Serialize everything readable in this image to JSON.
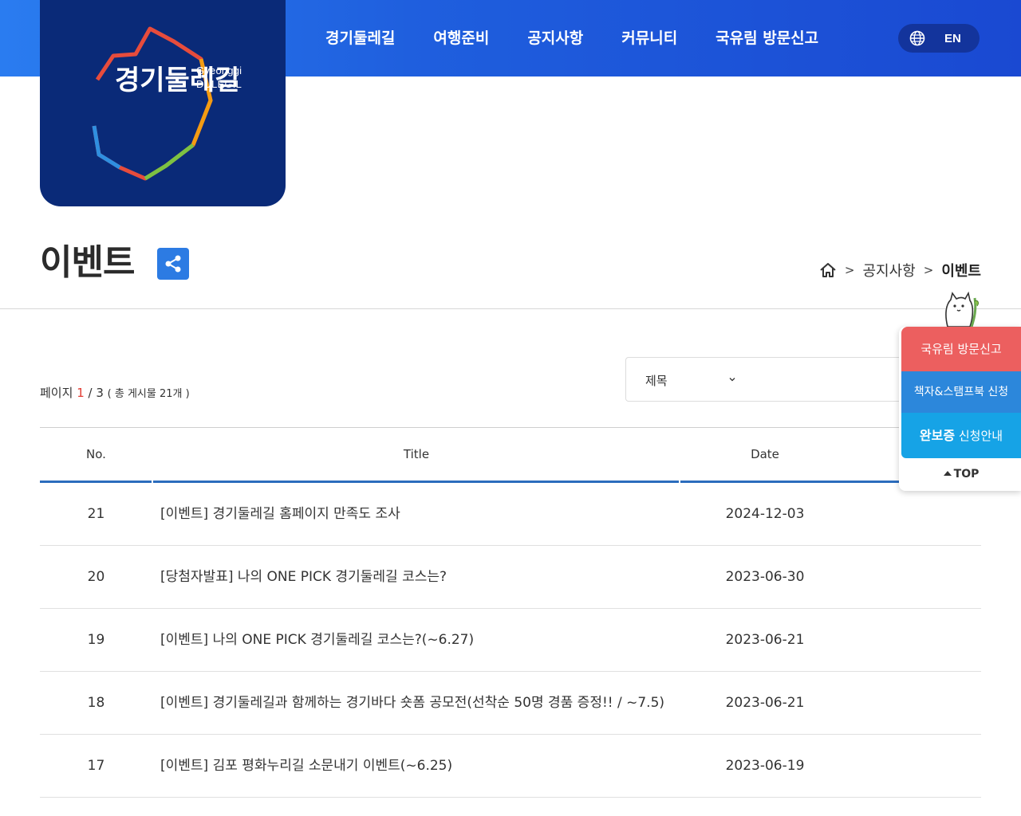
{
  "brand": {
    "logo_ko": "경기둘레길",
    "logo_en_line1": "Gyeonggi",
    "logo_en_line2": "DULEGIL"
  },
  "nav": {
    "items": [
      "경기둘레길",
      "여행준비",
      "공지사항",
      "커뮤니티",
      "국유림 방문신고"
    ],
    "lang_label": "EN"
  },
  "page": {
    "title": "이벤트"
  },
  "breadcrumb": {
    "items": [
      "공지사항",
      "이벤트"
    ]
  },
  "list_info": {
    "prefix": "페이지",
    "current_page": "1",
    "total_pages": "/ 3",
    "total_posts": "( 총 게시물 21개 )"
  },
  "search": {
    "field_selected": "제목"
  },
  "table": {
    "headers": [
      "No.",
      "Title",
      "Date"
    ],
    "rows": [
      {
        "no": "21",
        "title": "[이벤트] 경기둘레길 홈페이지 만족도 조사",
        "date": "2024-12-03"
      },
      {
        "no": "20",
        "title": "[당첨자발표] 나의 ONE PICK 경기둘레길 코스는?",
        "date": "2023-06-30"
      },
      {
        "no": "19",
        "title": "[이벤트] 나의 ONE PICK 경기둘레길 코스는?(~6.27)",
        "date": "2023-06-21"
      },
      {
        "no": "18",
        "title": "[이벤트] 경기둘레길과 함께하는 경기바다 숏폼 공모전(선착순 50명 경품 증정!! / ~7.5)",
        "date": "2023-06-21"
      },
      {
        "no": "17",
        "title": "[이벤트] 김포 평화누리길 소문내기 이벤트(~6.25)",
        "date": "2023-06-19"
      }
    ]
  },
  "quick_menu": {
    "visit_report": "국유림 방문신고",
    "stampbook": "책자&스탬프북 신청",
    "complete_bold": "완보증",
    "complete_rest": " 신청안내",
    "top": "TOP"
  },
  "colors": {
    "header_blue": "#1f5fde",
    "logo_navy": "#0a2a78",
    "accent_red": "#e23c33",
    "quick_red": "#ec5f5f",
    "quick_blue": "#2c87db",
    "quick_sky": "#16a3e6",
    "table_line": "#2b6cbd"
  }
}
